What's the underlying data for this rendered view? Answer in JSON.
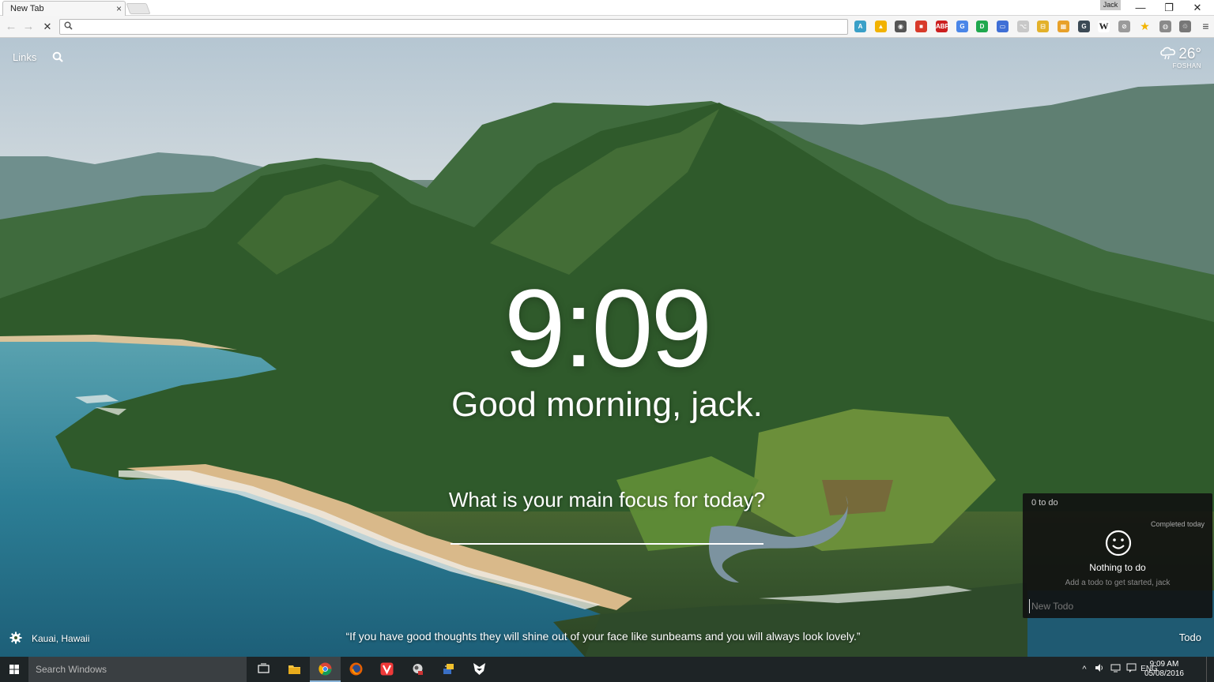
{
  "browser": {
    "tab_title": "New Tab",
    "tab_close": "×",
    "profile_name": "Jack",
    "window_controls": {
      "minimize": "—",
      "restore": "❐",
      "close": "✕"
    },
    "nav": {
      "back": "←",
      "forward": "→",
      "stop": "✕"
    },
    "omnibox": {
      "value": "",
      "placeholder": ""
    },
    "extensions": [
      {
        "name": "translate-icon",
        "color": "#3aa0c8",
        "label": "A"
      },
      {
        "name": "google-drive-icon",
        "color": "#f2b200",
        "label": "▲"
      },
      {
        "name": "incognito-icon",
        "color": "#555555",
        "label": "◉"
      },
      {
        "name": "bookmark-icon",
        "color": "#d83a2a",
        "label": "■"
      },
      {
        "name": "adblock-plus-icon",
        "color": "#cc1f1f",
        "label": "ABP"
      },
      {
        "name": "google-translate-icon",
        "color": "#4a86e8",
        "label": "G"
      },
      {
        "name": "green-circle-icon",
        "color": "#1fa84e",
        "label": "D"
      },
      {
        "name": "window-icon",
        "color": "#3f6fd6",
        "label": "▭"
      },
      {
        "name": "document-icon",
        "color": "#c8c8c8",
        "label": "⌥"
      },
      {
        "name": "ticket-icon",
        "color": "#e3b12a",
        "label": "⊟"
      },
      {
        "name": "grid-icon",
        "color": "#e8a12a",
        "label": "▦"
      },
      {
        "name": "grammarly-icon",
        "color": "#3c4a55",
        "label": "G"
      },
      {
        "name": "wikipedia-icon",
        "color": "#ffffff",
        "label": "W"
      },
      {
        "name": "compass-icon",
        "color": "#9a9a9a",
        "label": "⊘"
      },
      {
        "name": "star-icon",
        "color": "#f2b400",
        "label": "★"
      },
      {
        "name": "globe-icon",
        "color": "#8a8a8a",
        "label": "◍"
      },
      {
        "name": "recycle-icon",
        "color": "#777777",
        "label": "♲"
      },
      {
        "name": "menu-icon",
        "color": "#444444",
        "label": "≡"
      }
    ]
  },
  "momentum": {
    "links_label": "Links",
    "weather": {
      "temp": "26°",
      "city": "FOSHAN"
    },
    "time": "9:09",
    "greeting": "Good morning, jack.",
    "focus_question": "What is your main focus for today?",
    "focus_value": "",
    "location": "Kauai, Hawaii",
    "quote": "“If you have good thoughts they will shine out of your face like sunbeams and you will always look lovely.”",
    "todo_link": "Todo",
    "todo": {
      "count": "0 to do",
      "completed": "Completed today",
      "empty_title": "Nothing to do",
      "empty_hint": "Add a todo to get started, jack",
      "new_placeholder": "New Todo"
    }
  },
  "taskbar": {
    "search_placeholder": "Search Windows",
    "apps": [
      "task-view-icon",
      "file-explorer-icon",
      "chrome-icon",
      "firefox-icon",
      "vivaldi-icon",
      "app-icon",
      "network-app-icon",
      "foxy-icon"
    ],
    "tray": {
      "language": "ENG"
    },
    "clock_time": "9:09 AM",
    "clock_date": "05/08/2016"
  },
  "colors": {
    "accent": "#8ab4d8",
    "taskbar_bg": "#1e2426",
    "todo_bg": "#111111"
  }
}
